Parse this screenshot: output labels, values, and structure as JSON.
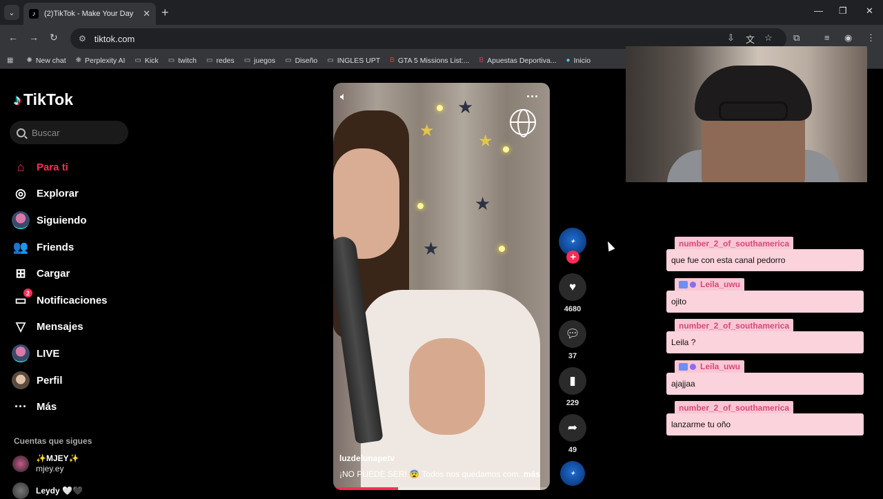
{
  "browser": {
    "tab_title": "(2)TikTok - Make Your Day",
    "url": "tiktok.com",
    "bookmarks": [
      "New chat",
      "Perplexity AI",
      "Kick",
      "twitch",
      "redes",
      "juegos",
      "Diseño",
      "INGLES UPT",
      "GTA 5 Missions List:...",
      "Apuestas Deportiva...",
      "Inicio"
    ]
  },
  "tiktok": {
    "brand": "TikTok",
    "search_placeholder": "Buscar",
    "menu": [
      "Para ti",
      "Explorar",
      "Siguiendo",
      "Friends",
      "Cargar",
      "Notificaciones",
      "Mensajes",
      "LIVE",
      "Perfil",
      "Más"
    ],
    "notifications_badge": "2",
    "following_title": "Cuentas que sigues",
    "following": [
      {
        "name": "✨MJEY✨",
        "handle": "mjey.ey"
      },
      {
        "name": "Leydy 🤍🖤",
        "handle": ""
      }
    ]
  },
  "video": {
    "author": "luzdelunapetv",
    "description": "¡NO PUEDE SER! 😨 Todos nos quedamos com...",
    "more_label": "más",
    "progress": 0.3,
    "likes": "4680",
    "comments": "37",
    "saves": "229",
    "shares": "49"
  },
  "chat": [
    {
      "user": "number_2_of_southamerica",
      "message": "que fue con esta canal pedorro",
      "badges": false
    },
    {
      "user": "Leila_uwu",
      "message": "ojito",
      "badges": true
    },
    {
      "user": "number_2_of_southamerica",
      "message": "Leila ?",
      "badges": false
    },
    {
      "user": "Leila_uwu",
      "message": "ajajjaa",
      "badges": true
    },
    {
      "user": "number_2_of_southamerica",
      "message": "lanzarme tu oño",
      "badges": false
    }
  ],
  "colors": {
    "accent": "#fe2c55",
    "chat_bg": "#fbd3dc",
    "chat_name": "#d64a77"
  }
}
